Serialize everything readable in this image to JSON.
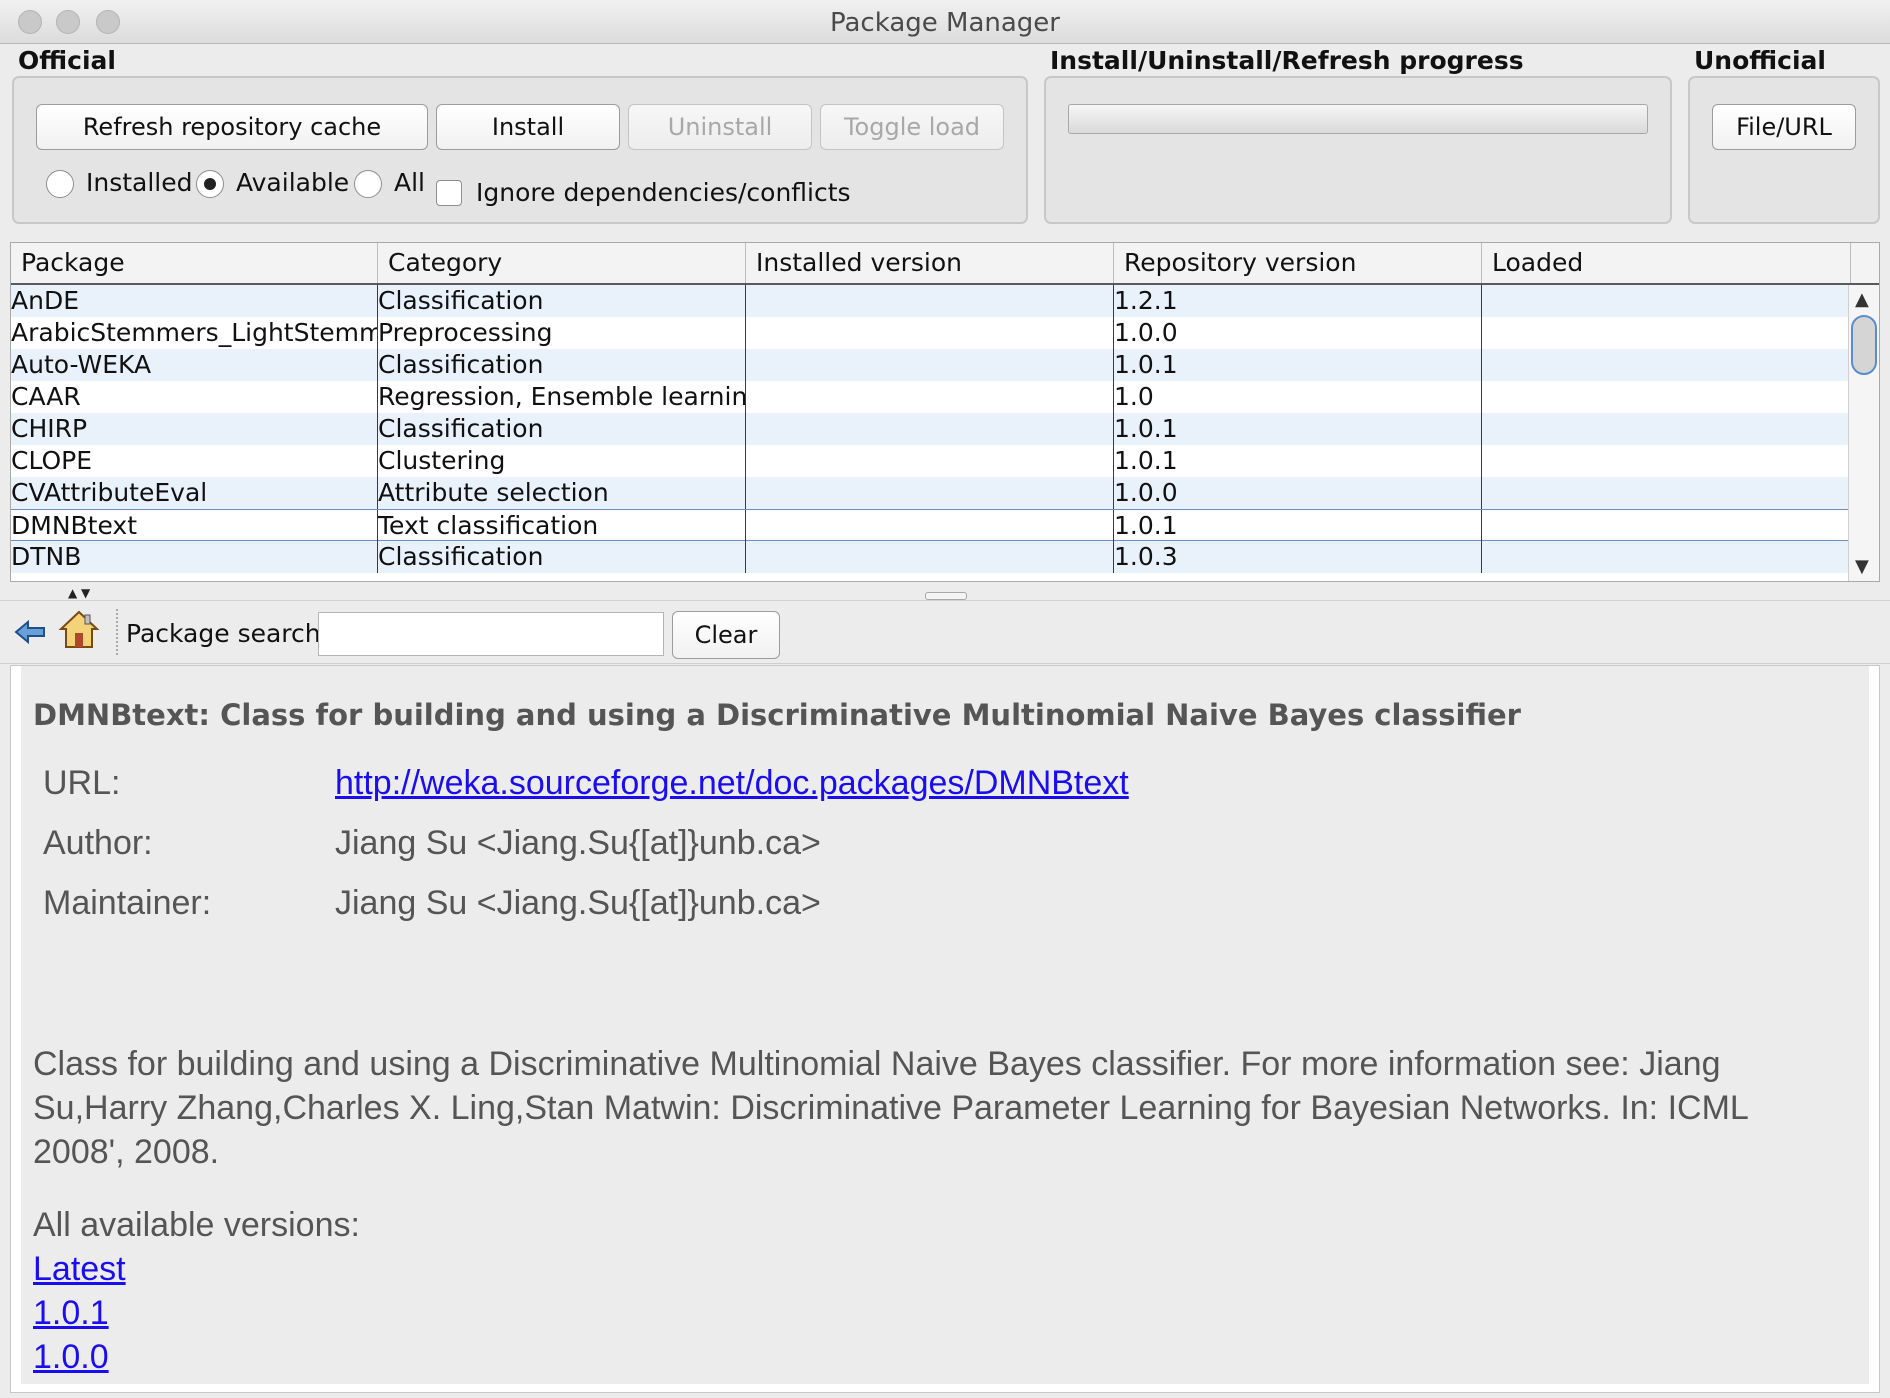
{
  "window": {
    "title": "Package Manager"
  },
  "official": {
    "label": "Official",
    "refresh_label": "Refresh repository cache",
    "install_label": "Install",
    "uninstall_label": "Uninstall",
    "toggle_load_label": "Toggle load",
    "filter": {
      "installed": "Installed",
      "available": "Available",
      "all": "All",
      "selected": "Available"
    },
    "ignore_deps_label": "Ignore dependencies/conflicts"
  },
  "progress": {
    "label": "Install/Uninstall/Refresh progress",
    "value": 0
  },
  "unofficial": {
    "label": "Unofficial",
    "file_url_label": "File/URL"
  },
  "table": {
    "columns": [
      "Package",
      "Category",
      "Installed version",
      "Repository version",
      "Loaded"
    ],
    "rows": [
      [
        "AnDE",
        "Classification",
        "",
        "1.2.1",
        ""
      ],
      [
        "ArabicStemmers_LightStemm...",
        "Preprocessing",
        "",
        "1.0.0",
        ""
      ],
      [
        "Auto-WEKA",
        "Classification",
        "",
        "1.0.1",
        ""
      ],
      [
        "CAAR",
        "Regression, Ensemble learning",
        "",
        "1.0",
        ""
      ],
      [
        "CHIRP",
        "Classification",
        "",
        "1.0.1",
        ""
      ],
      [
        "CLOPE",
        "Clustering",
        "",
        "1.0.1",
        ""
      ],
      [
        "CVAttributeEval",
        "Attribute selection",
        "",
        "1.0.0",
        ""
      ],
      [
        "DMNBtext",
        "Text classification",
        "",
        "1.0.1",
        ""
      ],
      [
        "DTNB",
        "Classification",
        "",
        "1.0.3",
        ""
      ]
    ]
  },
  "toolbar": {
    "search_label": "Package search",
    "search_value": "",
    "clear_label": "Clear"
  },
  "details": {
    "title": "DMNBtext: Class for building and using a Discriminative Multinomial Naive Bayes classifier",
    "url_key": "URL:",
    "url_value": "http://weka.sourceforge.net/doc.packages/DMNBtext",
    "author_key": "Author:",
    "author_value": "Jiang Su <Jiang.Su{[at]}unb.ca>",
    "maintainer_key": "Maintainer:",
    "maintainer_value": "Jiang Su <Jiang.Su{[at]}unb.ca>",
    "description": "Class for building and using a Discriminative Multinomial Naive Bayes classifier. For more information see: Jiang Su,Harry Zhang,Charles X. Ling,Stan Matwin: Discriminative Parameter Learning for Bayesian Networks. In: ICML 2008', 2008.",
    "versions_label": "All available versions:",
    "versions": [
      "Latest",
      "1.0.1",
      "1.0.0"
    ]
  },
  "colors": {
    "link": "#1a0dee",
    "row_alt": "#e9f1fb",
    "selection_border": "#6a8fc0"
  }
}
